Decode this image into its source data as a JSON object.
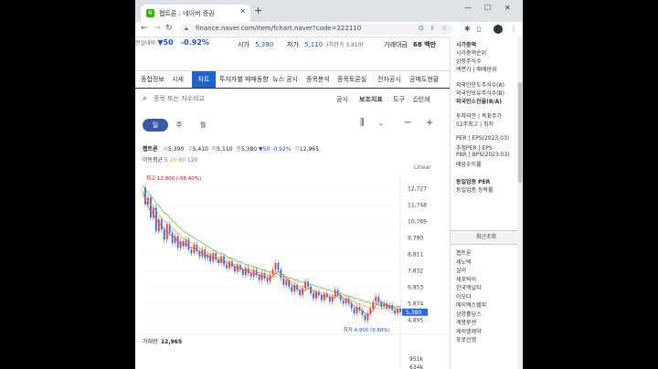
{
  "browser": {
    "tab_title": "펩트론 : 네이버 증권",
    "url": "finance.naver.com/item/fchart.naver?code=222110",
    "new_tab": "+",
    "min": "—",
    "max": "☐",
    "close": "✕"
  },
  "quote": {
    "prev_close_label": "전일대비",
    "change": "▼50",
    "change_pct": "-0.92%",
    "open_label": "시가",
    "open": "5,390",
    "low_label": "저가",
    "low": "5,110",
    "low_limit": "(하한가 3,810)",
    "amount_label": "거래대금",
    "amount": "68 백만"
  },
  "nav": {
    "items": [
      "종합정보",
      "시세",
      "차트",
      "투자자별 매매동향",
      "뉴스 공시",
      "종목분석",
      "종목토론실",
      "전자공시",
      "공매도현황"
    ],
    "active": "차트"
  },
  "search": {
    "placeholder": "종목 또는 지수비교",
    "tools": [
      "공시",
      "보조지표",
      "도구",
      "인쇄"
    ]
  },
  "period": {
    "day": "일",
    "week": "주",
    "month": "월"
  },
  "summary": {
    "name": "펩트론",
    "open_l": "시",
    "open": "5,390",
    "high_l": "고",
    "high": "5,410",
    "low_l": "저",
    "low": "5,110",
    "close_l": "종",
    "close": "5,380",
    "chg": "▼50",
    "chg_pct": "-0.92%",
    "vol_l": "거",
    "vol": "12,965"
  },
  "ma": {
    "label": "이동평균",
    "p5": "5",
    "p20": "20",
    "p60": "60",
    "p120": "120"
  },
  "chart_data": {
    "type": "line",
    "scale": "Linear",
    "yticks": [
      "12,727",
      "11,748",
      "10,769",
      "9,790",
      "8,811",
      "7,832",
      "6,853",
      "5,874",
      "4,895"
    ],
    "ylim": [
      4500,
      13300
    ],
    "max_label": "최고 12,800 (-58.40%)",
    "min_label": "최저 4,900 (9.80%)",
    "last_label": "5,380",
    "close": [
      12800,
      11800,
      12200,
      11000,
      11600,
      10200,
      10900,
      10300,
      9700,
      10600,
      10100,
      9500,
      9900,
      9200,
      9600,
      9300,
      9700,
      9100,
      8900,
      9400,
      9000,
      8700,
      9100,
      8600,
      8800,
      8400,
      8900,
      8500,
      8300,
      8700,
      8200,
      8000,
      8400,
      8100,
      7800,
      8200,
      7900,
      7600,
      8000,
      7700,
      7500,
      7900,
      7600,
      7300,
      7700,
      7400,
      7200,
      7600,
      7900,
      8300,
      7900,
      7400,
      7000,
      7300,
      6900,
      6600,
      7000,
      6700,
      6400,
      6800,
      7200,
      6900,
      6500,
      6200,
      6600,
      6400,
      6100,
      6500,
      6300,
      6000,
      6300,
      6700,
      6400,
      6100,
      5900,
      6200,
      5900,
      5600,
      5300,
      5700,
      5500,
      5200,
      4900,
      5300,
      5600,
      6000,
      6300,
      6000,
      5700,
      5900,
      5600,
      5800,
      5500,
      5300,
      5600,
      5380
    ],
    "ma5": [
      12600,
      12000,
      11700,
      11400,
      11200,
      10900,
      10700,
      10500,
      10300,
      10200,
      10000,
      9900,
      9800,
      9600,
      9500,
      9400,
      9400,
      9300,
      9200,
      9200,
      9100,
      9000,
      8900,
      8800,
      8700,
      8700,
      8600,
      8600,
      8500,
      8500,
      8400,
      8300,
      8200,
      8200,
      8100,
      8000,
      8000,
      7900,
      7900,
      7800,
      7700,
      7700,
      7600,
      7600,
      7500,
      7500,
      7400,
      7400,
      7500,
      7700,
      7800,
      7700,
      7600,
      7400,
      7200,
      7000,
      6900,
      6800,
      6700,
      6600,
      6700,
      6800,
      6800,
      6600,
      6500,
      6400,
      6400,
      6300,
      6300,
      6300,
      6200,
      6300,
      6400,
      6400,
      6200,
      6100,
      6000,
      5900,
      5700,
      5600,
      5500,
      5500,
      5300,
      5200,
      5300,
      5500,
      5800,
      6000,
      6000,
      5900,
      5800,
      5700,
      5700,
      5600,
      5500,
      5480
    ],
    "ma20": [
      12400,
      12200,
      12000,
      11800,
      11600,
      11400,
      11200,
      11000,
      10800,
      10700,
      10500,
      10400,
      10200,
      10100,
      9900,
      9800,
      9700,
      9600,
      9500,
      9400,
      9300,
      9200,
      9100,
      9000,
      8900,
      8800,
      8800,
      8700,
      8600,
      8600,
      8500,
      8400,
      8400,
      8300,
      8200,
      8200,
      8100,
      8000,
      8000,
      7900,
      7900,
      7800,
      7800,
      7700,
      7700,
      7600,
      7600,
      7500,
      7500,
      7500,
      7500,
      7500,
      7400,
      7400,
      7300,
      7200,
      7100,
      7000,
      6900,
      6900,
      6800,
      6800,
      6700,
      6700,
      6600,
      6600,
      6500,
      6500,
      6400,
      6400,
      6400,
      6300,
      6300,
      6300,
      6200,
      6200,
      6100,
      6100,
      6000,
      5900,
      5900,
      5800,
      5700,
      5700,
      5600,
      5600,
      5600,
      5600,
      5600,
      5600,
      5600,
      5600,
      5600,
      5600,
      5600,
      5600
    ],
    "ma60": [
      12900,
      12700,
      12500,
      12300,
      12100,
      11900,
      11700,
      11500,
      11300,
      11200,
      11000,
      10800,
      10700,
      10500,
      10400,
      10200,
      10100,
      10000,
      9900,
      9800,
      9700,
      9600,
      9500,
      9400,
      9300,
      9200,
      9100,
      9000,
      8900,
      8900,
      8800,
      8700,
      8600,
      8600,
      8500,
      8400,
      8400,
      8300,
      8200,
      8200,
      8100,
      8100,
      8000,
      8000,
      7900,
      7900,
      7800,
      7800,
      7700,
      7700,
      7600,
      7600,
      7500,
      7500,
      7400,
      7400,
      7300,
      7300,
      7200,
      7200,
      7100,
      7100,
      7000,
      7000,
      6900,
      6900,
      6800,
      6800,
      6700,
      6700,
      6600,
      6600,
      6500,
      6500,
      6400,
      6400,
      6300,
      6300,
      6200,
      6200,
      6100,
      6100,
      6000,
      6000,
      5900,
      5900,
      5900,
      5800,
      5800,
      5800,
      5800,
      5800,
      5700,
      5700,
      5700,
      5700
    ],
    "volume_label": "거래량",
    "volume_value": "12,965",
    "vol_ticks": [
      "951k",
      "634k"
    ]
  },
  "sidebar": {
    "group1": [
      "시가총액",
      "시가총액순위",
      "상장주식수",
      "액면가 | 매매단위"
    ],
    "group2": [
      "외국인한도주식수(A)",
      "외국인보유주식수(B)",
      "외국인소진율(B/A)"
    ],
    "group3": [
      "투자의견 | 목표주가",
      "52주최고 | 최저"
    ],
    "group4": [
      "PER | EPS(2023.03)",
      "추정PER | EPS",
      "PBR | BPS(2023.03)",
      "배당수익률"
    ],
    "group5": [
      "동일업종 PER",
      "동일업종 등락률"
    ],
    "recent_title": "최근조회",
    "recent": [
      "펩트론",
      "세노텍",
      "실리",
      "세포틱이",
      "한국맥널티",
      "이모다",
      "에이엑스텔피",
      "삼양홀딩스",
      "계봉루센",
      "케이엠제약",
      "포로선엠"
    ]
  }
}
